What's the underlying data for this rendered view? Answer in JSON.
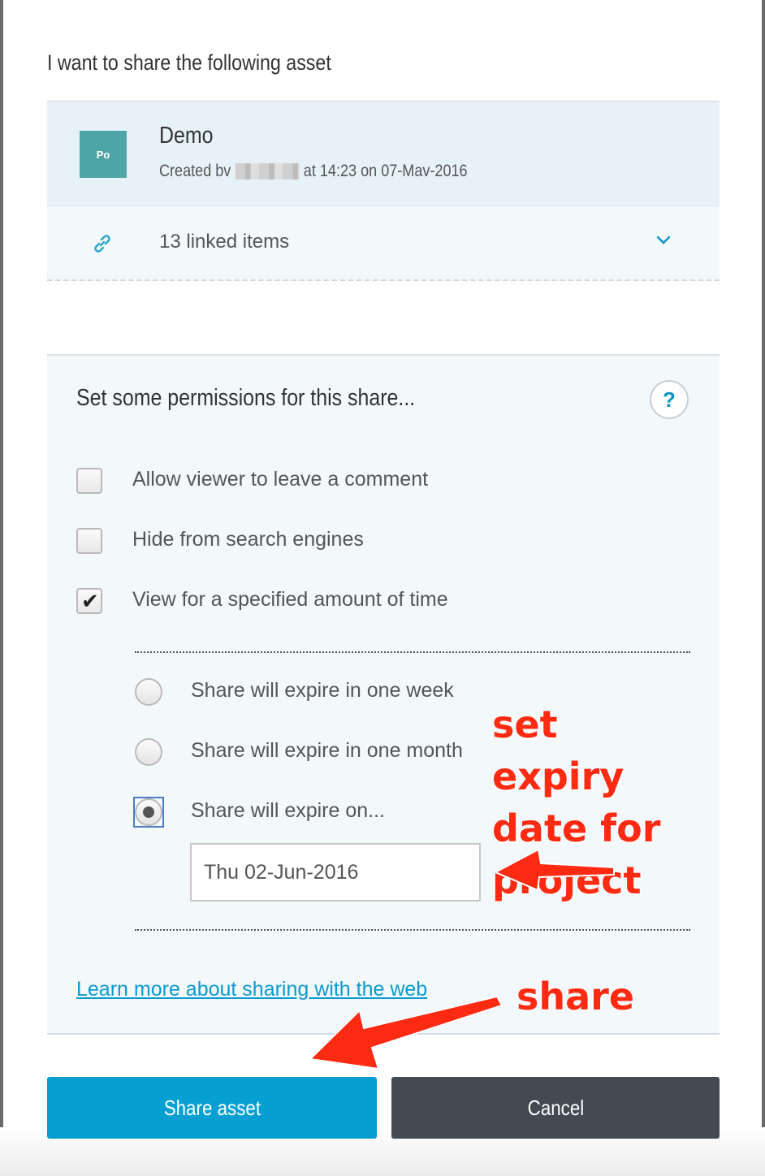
{
  "dialog": {
    "heading": "I want to share the following asset"
  },
  "asset": {
    "thumb_label": "Po",
    "title": "Demo",
    "created_prefix": "Created bv",
    "created_suffix": "at 14:23 on 07-Mav-2016"
  },
  "linked": {
    "icon": "link-icon",
    "label": "13 linked items",
    "toggle_icon": "chevron-down-icon"
  },
  "permissions": {
    "title": "Set some permissions for this share...",
    "help_symbol": "?",
    "options": [
      {
        "label": "Allow viewer to leave a comment",
        "checked": false
      },
      {
        "label": "Hide from search engines",
        "checked": false
      },
      {
        "label": "View for a specified amount of time",
        "checked": true
      }
    ],
    "expiry": {
      "choices": [
        {
          "label": "Share will expire in one week",
          "selected": false
        },
        {
          "label": "Share will expire in one month",
          "selected": false
        },
        {
          "label": "Share will expire on...",
          "selected": true
        }
      ],
      "date_value": "Thu 02-Jun-2016"
    },
    "learn_more": "Learn more about sharing with the web"
  },
  "buttons": {
    "share": "Share asset",
    "cancel": "Cancel"
  },
  "annotations": {
    "expiry_note_lines": [
      "set expiry",
      "date for",
      "project"
    ],
    "share_note": "share",
    "color": "#ff2a12"
  },
  "colors": {
    "accent": "#069fd1",
    "cancel": "#434a52",
    "thumb": "#4fa5a6",
    "link": "#0a9ad1"
  }
}
